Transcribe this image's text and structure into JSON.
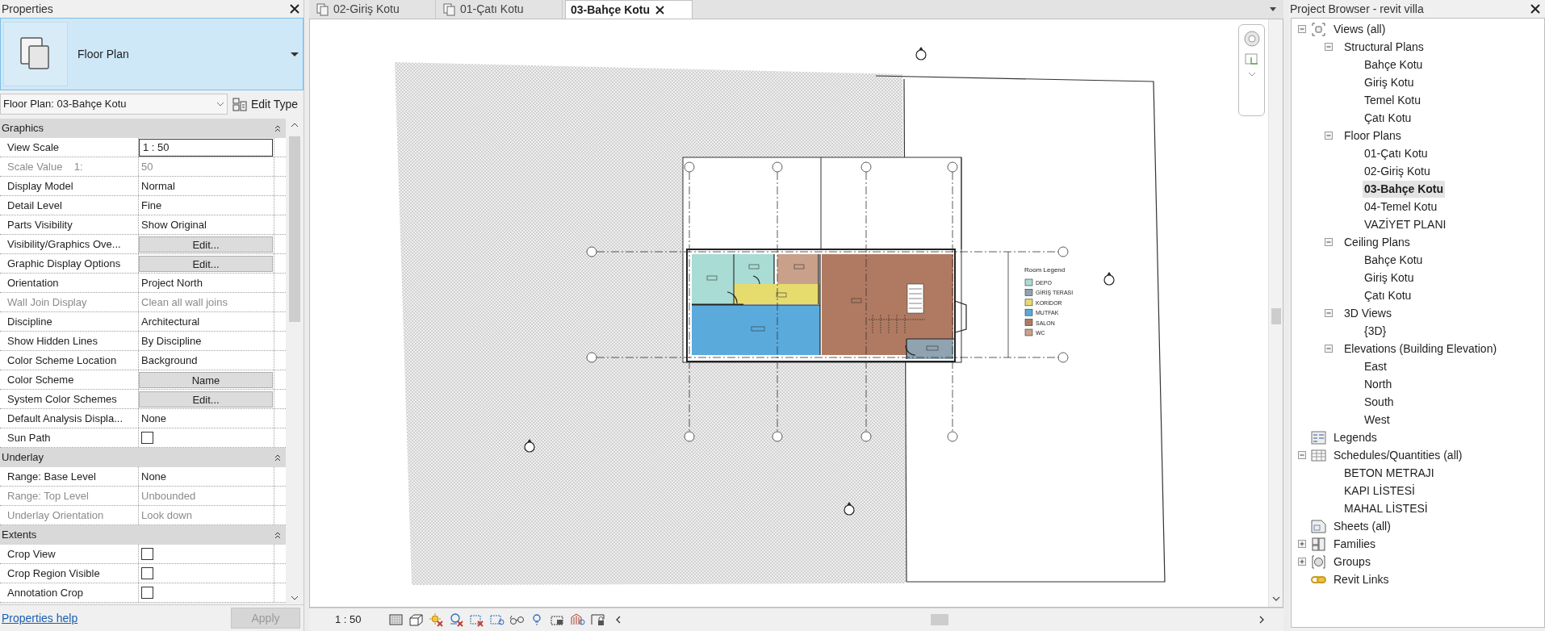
{
  "properties": {
    "title": "Properties",
    "type_name": "Floor Plan",
    "instance_selector": "Floor Plan: 03-Bahçe Kotu",
    "edit_type": "Edit Type",
    "groups": [
      {
        "name": "Graphics",
        "expanded": true,
        "rows": [
          {
            "label": "View Scale",
            "value": "1 : 50",
            "kind": "input",
            "disabled": false
          },
          {
            "label": "Scale Value    1:",
            "value": "50",
            "kind": "text",
            "disabled": true
          },
          {
            "label": "Display Model",
            "value": "Normal",
            "kind": "text",
            "disabled": false
          },
          {
            "label": "Detail Level",
            "value": "Fine",
            "kind": "text",
            "disabled": false
          },
          {
            "label": "Parts Visibility",
            "value": "Show Original",
            "kind": "text",
            "disabled": false
          },
          {
            "label": "Visibility/Graphics Ove...",
            "value": "Edit...",
            "kind": "button",
            "disabled": false
          },
          {
            "label": "Graphic Display Options",
            "value": "Edit...",
            "kind": "button",
            "disabled": false
          },
          {
            "label": "Orientation",
            "value": "Project North",
            "kind": "text",
            "disabled": false
          },
          {
            "label": "Wall Join Display",
            "value": "Clean all wall joins",
            "kind": "text",
            "disabled": true
          },
          {
            "label": "Discipline",
            "value": "Architectural",
            "kind": "text",
            "disabled": false
          },
          {
            "label": "Show Hidden Lines",
            "value": "By Discipline",
            "kind": "text",
            "disabled": false
          },
          {
            "label": "Color Scheme Location",
            "value": "Background",
            "kind": "text",
            "disabled": false
          },
          {
            "label": "Color Scheme",
            "value": "Name",
            "kind": "button",
            "disabled": false
          },
          {
            "label": "System Color Schemes",
            "value": "Edit...",
            "kind": "button",
            "disabled": false
          },
          {
            "label": "Default Analysis Displa...",
            "value": "None",
            "kind": "text",
            "disabled": false
          },
          {
            "label": "Sun Path",
            "kind": "checkbox",
            "checked": false,
            "disabled": false
          }
        ]
      },
      {
        "name": "Underlay",
        "expanded": true,
        "rows": [
          {
            "label": "Range: Base Level",
            "value": "None",
            "kind": "text",
            "disabled": false
          },
          {
            "label": "Range: Top Level",
            "value": "Unbounded",
            "kind": "text",
            "disabled": true
          },
          {
            "label": "Underlay Orientation",
            "value": "Look down",
            "kind": "text",
            "disabled": true
          }
        ]
      },
      {
        "name": "Extents",
        "expanded": true,
        "rows": [
          {
            "label": "Crop View",
            "kind": "checkbox",
            "checked": false,
            "disabled": false
          },
          {
            "label": "Crop Region Visible",
            "kind": "checkbox",
            "checked": false,
            "disabled": false
          },
          {
            "label": "Annotation Crop",
            "kind": "checkbox",
            "checked": false,
            "disabled": false
          }
        ]
      }
    ],
    "help_link": "Properties help",
    "apply_button": {
      "label": "Apply",
      "disabled": true
    }
  },
  "tabs": [
    {
      "label": "02-Giriş Kotu",
      "selected": false
    },
    {
      "label": "01-Çatı Kotu",
      "selected": false
    },
    {
      "label": "03-Bahçe Kotu",
      "selected": true
    }
  ],
  "room_legend": {
    "title": "Room Legend",
    "entries": [
      {
        "label": "DEPO",
        "color": "#a8dcd4"
      },
      {
        "label": "GİRİŞ TERASI",
        "color": "#8fa3b0"
      },
      {
        "label": "KORİDOR",
        "color": "#e6dc6e"
      },
      {
        "label": "MUTFAK",
        "color": "#5aaadc"
      },
      {
        "label": "SALON",
        "color": "#b07a62"
      },
      {
        "label": "WC",
        "color": "#c9a08a"
      }
    ]
  },
  "status_bar": {
    "scale": "1 : 50"
  },
  "project_browser": {
    "title": "Project Browser - revit villa",
    "tree": [
      {
        "label": "Views (all)",
        "kind": "views",
        "expanded": true,
        "selected": false,
        "children": [
          {
            "label": "Structural Plans",
            "expanded": true,
            "selected": false,
            "children": [
              {
                "label": "Bahçe Kotu",
                "selected": false
              },
              {
                "label": "Giriş Kotu",
                "selected": false
              },
              {
                "label": "Temel Kotu",
                "selected": false
              },
              {
                "label": "Çatı Kotu",
                "selected": false
              }
            ]
          },
          {
            "label": "Floor Plans",
            "expanded": true,
            "selected": false,
            "children": [
              {
                "label": "01-Çatı Kotu",
                "selected": false
              },
              {
                "label": "02-Giriş Kotu",
                "selected": false
              },
              {
                "label": "03-Bahçe Kotu",
                "selected": true
              },
              {
                "label": "04-Temel Kotu",
                "selected": false
              },
              {
                "label": "VAZİYET PLANI",
                "selected": false
              }
            ]
          },
          {
            "label": "Ceiling Plans",
            "expanded": true,
            "selected": false,
            "children": [
              {
                "label": "Bahçe Kotu",
                "selected": false
              },
              {
                "label": "Giriş Kotu",
                "selected": false
              },
              {
                "label": "Çatı Kotu",
                "selected": false
              }
            ]
          },
          {
            "label": "3D Views",
            "expanded": true,
            "selected": false,
            "children": [
              {
                "label": "{3D}",
                "selected": false
              }
            ]
          },
          {
            "label": "Elevations (Building Elevation)",
            "expanded": true,
            "selected": false,
            "children": [
              {
                "label": "East",
                "selected": false
              },
              {
                "label": "North",
                "selected": false
              },
              {
                "label": "South",
                "selected": false
              },
              {
                "label": "West",
                "selected": false
              }
            ]
          }
        ]
      },
      {
        "label": "Legends",
        "kind": "legends",
        "selected": false
      },
      {
        "label": "Schedules/Quantities (all)",
        "kind": "schedules",
        "expanded": true,
        "selected": false,
        "children": [
          {
            "label": "BETON METRAJI",
            "selected": false
          },
          {
            "label": "KAPI LİSTESİ",
            "selected": false
          },
          {
            "label": "MAHAL LİSTESİ",
            "selected": false
          }
        ]
      },
      {
        "label": "Sheets (all)",
        "kind": "sheets",
        "selected": false
      },
      {
        "label": "Families",
        "kind": "families",
        "expanded": false,
        "selected": false
      },
      {
        "label": "Groups",
        "kind": "groups",
        "expanded": false,
        "selected": false
      },
      {
        "label": "Revit Links",
        "kind": "links",
        "selected": false
      }
    ]
  }
}
